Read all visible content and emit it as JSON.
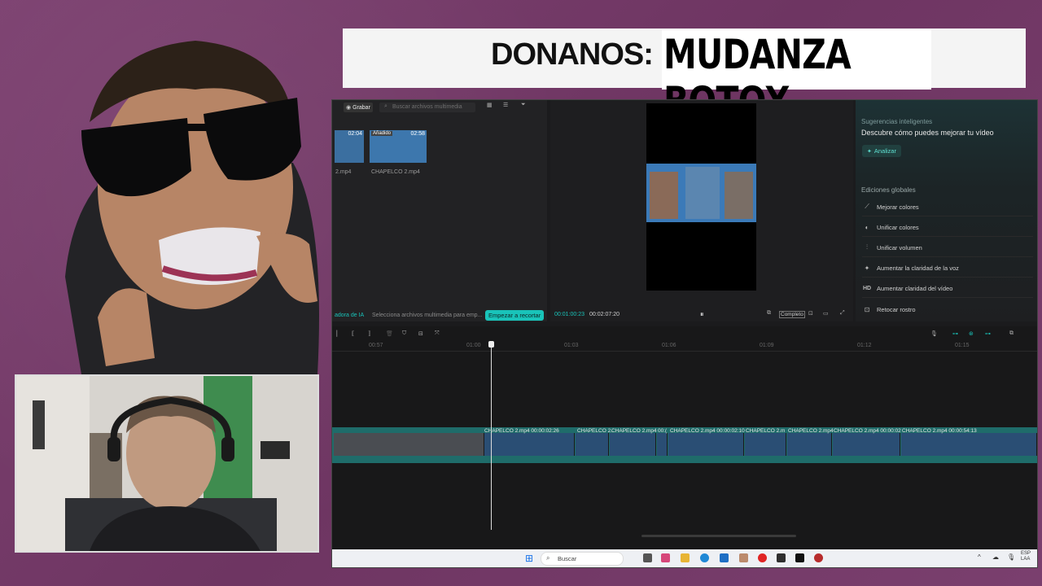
{
  "banner": {
    "label": "DONANOS:",
    "name": "MUDANZA BOTOX"
  },
  "editor": {
    "media": {
      "tab_record": "Grabar",
      "search_placeholder": "Buscar archivos multimedia",
      "added_badge": "Añadido",
      "thumb1_duration": "02:04",
      "thumb2_duration": "02:58",
      "file_left": "2.mp4",
      "file_right": "CHAPELCO 2.mp4",
      "ai_label": "adora de IA",
      "ai_hint": "Selecciona archivos multimedia para emp...",
      "start_crop_button": "Empezar a recortar"
    },
    "preview": {
      "current_time": "00:01:00:23",
      "total_time": "00:02:07:20",
      "ratio_button": "Completo"
    },
    "smart": {
      "title": "Sugerencias inteligentes",
      "subtitle": "Descubre cómo puedes mejorar tu vídeo",
      "analyze_button": "Analizar",
      "global_title": "Ediciones globales",
      "items": [
        {
          "icon": "magic-wand-icon",
          "glyph": "⟋",
          "label": "Mejorar colores"
        },
        {
          "icon": "palette-icon",
          "glyph": "◐",
          "label": "Unificar colores"
        },
        {
          "icon": "sliders-icon",
          "glyph": "⫶",
          "label": "Unificar volumen"
        },
        {
          "icon": "voice-icon",
          "glyph": "✦",
          "label": "Aumentar la claridad de la voz"
        },
        {
          "icon": "hd-icon",
          "glyph": "HD",
          "label": "Aumentar claridad del vídeo"
        },
        {
          "icon": "retouch-icon",
          "glyph": "⊡",
          "label": "Retocar rostro"
        }
      ]
    },
    "timeline": {
      "ruler": [
        "00:57",
        "01:00",
        "01:03",
        "01:06",
        "01:09",
        "01:12",
        "01:15"
      ],
      "clip_labels": [
        {
          "text": "CHAPELCO 2.mp4   00:00:02:26"
        },
        {
          "text": "CHAPELCO 2."
        },
        {
          "text": "CHAPELCO 2.mp4"
        },
        {
          "text": "00:("
        },
        {
          "text": "CHAPELCO 2.mp4   00:00:02:10"
        },
        {
          "text": "CHAPELCO 2.m"
        },
        {
          "text": "CHAPELCO 2.mp4"
        },
        {
          "text": "CHAPELCO 2.mp4   00:00:02"
        },
        {
          "text": "CHAPELCO 2.mp4   00:00:54:13"
        }
      ]
    },
    "taskbar": {
      "search_placeholder": "Buscar",
      "lang_top": "ESP",
      "lang_bottom": "LAA"
    }
  },
  "colors": {
    "background": "#7a3f6e",
    "accent_teal": "#19c3b9",
    "track": "#1f6c6a"
  }
}
